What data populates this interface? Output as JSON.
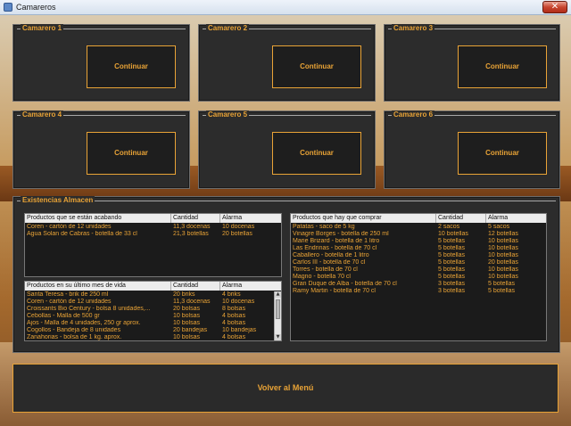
{
  "window": {
    "title": "Camareros",
    "close_glyph": "✕"
  },
  "waiters": [
    {
      "label": "Camarero 1",
      "button": "Continuar"
    },
    {
      "label": "Camarero 2",
      "button": "Continuar"
    },
    {
      "label": "Camarero 3",
      "button": "Continuar"
    },
    {
      "label": "Camarero 4",
      "button": "Continuar"
    },
    {
      "label": "Camarero 5",
      "button": "Continuar"
    },
    {
      "label": "Camarero 6",
      "button": "Continuar"
    }
  ],
  "stock": {
    "legend": "Existencias Almacen",
    "running_out": {
      "columns": [
        "Productos que se están acabando",
        "Cantidad",
        "Alarma"
      ],
      "rows": [
        [
          "Coren - cartón de 12 unidades",
          "11,3 docenas",
          "10 docenas"
        ],
        [
          "Agua Solan de Cabras - botella de 33 cl",
          "21,3 botellas",
          "20 botellas"
        ]
      ]
    },
    "expiring": {
      "columns": [
        "Productos en su último mes de vida",
        "Cantidad",
        "Alarma"
      ],
      "rows": [
        [
          "Santa Teresa - brik de 250 ml",
          "20 briks",
          "4 briks"
        ],
        [
          "Coren - cartón de 12 unidades",
          "11,3 docenas",
          "10 docenas"
        ],
        [
          "Croissants Bio Century - bolsa 8 unidades,...",
          "20 bolsas",
          "8 bolsas"
        ],
        [
          "Cebollas - Malla de 500 gr",
          "10 bolsas",
          "4 bolsas"
        ],
        [
          "Ajos - Malla de 4 unidades, 250 gr aprox.",
          "10 bolsas",
          "4 bolsas"
        ],
        [
          "Cogollos - Bandeja de 8 unidades",
          "20 bandejas",
          "10 bandejas"
        ],
        [
          "Zanahorias - bolsa de 1 kg. aprox.",
          "10 bolsas",
          "4 bolsas"
        ]
      ]
    },
    "to_buy": {
      "columns": [
        "Productos que hay que comprar",
        "Cantidad",
        "Alarma"
      ],
      "rows": [
        [
          "Patatas - saco de 5 kg",
          "2 sacos",
          "5 sacos"
        ],
        [
          "Vinagre Borges - botella de 250 ml",
          "10 botellas",
          "12 botellas"
        ],
        [
          "Marie Brizard - botella de 1 litro",
          "5 botellas",
          "10 botellas"
        ],
        [
          "Las Endrinas - botella de 70 cl",
          "5 botellas",
          "10 botellas"
        ],
        [
          "Caballero - botella de 1 litro",
          "5 botellas",
          "10 botellas"
        ],
        [
          "Carlos III - botella de 70 cl",
          "5 botellas",
          "20 botellas"
        ],
        [
          "Torres - botella de 70 cl",
          "5 botellas",
          "10 botellas"
        ],
        [
          "Magno - botella 70 cl",
          "5 botellas",
          "10 botellas"
        ],
        [
          "Gran Duque de Alba - botella de 70 cl",
          "3 botellas",
          "5 botellas"
        ],
        [
          "Ramy Martin - botella de 70 cl",
          "3 botellas",
          "5 botellas"
        ]
      ]
    }
  },
  "back_button": "Volver al Menú",
  "colors": {
    "accent": "#e9a336",
    "panel": "#2c2c2c"
  }
}
